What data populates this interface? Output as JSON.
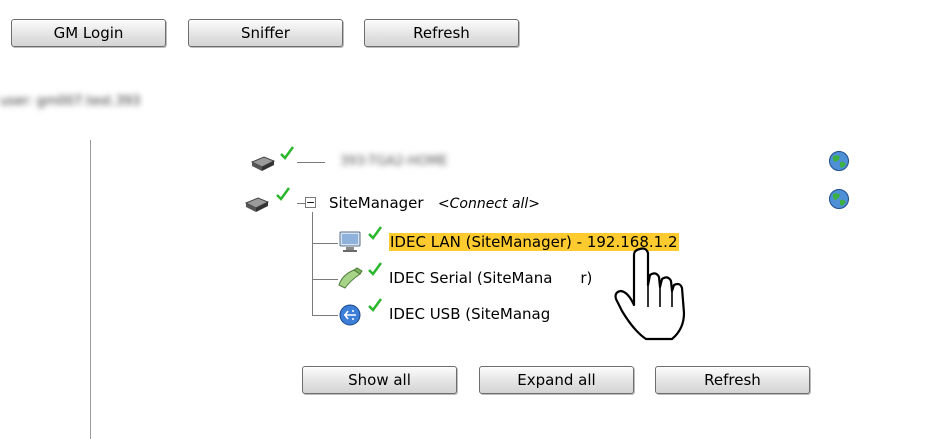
{
  "top_buttons": [
    "GM Login",
    "Sniffer",
    "Refresh"
  ],
  "account": {
    "blurred_text": "user: gm007.test.393"
  },
  "tree": {
    "device1": {
      "blurred_label": "393-TGA2-HOME",
      "status_icon": "check-icon"
    },
    "sitemanager": {
      "label": "SiteManager",
      "connect_all": "<Connect all>",
      "expander": "⊟",
      "children": [
        {
          "label": "IDEC LAN (SiteManager) - 192.168.1.2",
          "icon": "monitor-icon",
          "selected": true
        },
        {
          "label": "IDEC Serial (SiteManager)",
          "visible_label": "IDEC Serial (SiteMana",
          "tail": "r)",
          "icon": "serial-icon"
        },
        {
          "label": "IDEC USB (SiteManager)",
          "visible_label": "IDEC USB (SiteManag",
          "icon": "usb-icon"
        }
      ]
    }
  },
  "bottom_buttons": [
    "Show all",
    "Expand all",
    "Refresh"
  ],
  "colors": {
    "highlight": "#ffcb2f",
    "check": "#2bb52b",
    "globe": "#2e8b57"
  }
}
